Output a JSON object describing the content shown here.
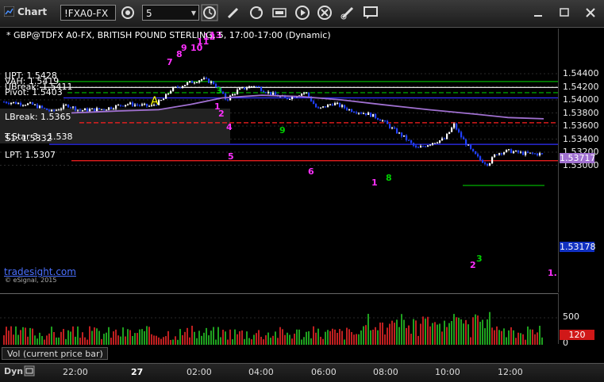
{
  "window": {
    "title": "Chart",
    "symbol": "!FXA0-FX",
    "interval": "5"
  },
  "chart_header": "* GBP@TDFX A0-FX, BRITISH POUND STERLING, 5, 17:00-17:00 (Dynamic)",
  "levels": [
    {
      "label": "UPT: 1.5428",
      "price": 1.5428,
      "color": "#00b000",
      "style": "solid"
    },
    {
      "label": "VAH: 1.5419",
      "price": 1.5419,
      "color": "#ffffff",
      "style": "solid"
    },
    {
      "label": "UBreak: 1.5411",
      "price": 1.5411,
      "color": "#00c000",
      "style": "dashed"
    },
    {
      "label": "Pivot: 1.5403",
      "price": 1.5403,
      "color": "#3030ff",
      "style": "solid"
    },
    {
      "label": "LBreak: 1.5365",
      "price": 1.5365,
      "color": "#ff2020",
      "style": "dashed"
    },
    {
      "label": "S1: 1.5332",
      "price": 1.5332,
      "color": "#3030ff",
      "style": "solid"
    },
    {
      "label": "LPT: 1.5307",
      "price": 1.5307,
      "color": "#ff2020",
      "style": "solid"
    }
  ],
  "tstar_label": "T.Star 3:",
  "tstar_value": "1.538",
  "marker_a": "A",
  "watermark": {
    "brand": "tradesight.com",
    "copyright": "© eSignal, 2015"
  },
  "price_axis": {
    "ticks": [
      "1.54400",
      "1.54200",
      "1.54000",
      "1.53800",
      "1.53600",
      "1.53400",
      "1.53200",
      "1.53000"
    ],
    "last_price": "1.53178",
    "ma_value": "1.53717"
  },
  "volume": {
    "label": "Vol (current price bar)",
    "ticks": [
      "500",
      "0"
    ],
    "last": "120"
  },
  "time_axis": [
    "22:00",
    "27",
    "02:00",
    "04:00",
    "06:00",
    "08:00",
    "10:00",
    "12:00"
  ],
  "bottom": {
    "mode": "Dyn"
  },
  "counts": [
    {
      "t": "7",
      "c": "#ff30ff"
    },
    {
      "t": "8",
      "c": "#ff30ff"
    },
    {
      "t": "9",
      "c": "#ff30ff"
    },
    {
      "t": "10",
      "c": "#ff30ff"
    },
    {
      "t": "11",
      "c": "#ff30ff"
    },
    {
      "t": "12",
      "c": "#ff30ff"
    },
    {
      "t": "13",
      "c": "#ff30ff"
    },
    {
      "t": "1",
      "c": "#ff30ff"
    },
    {
      "t": "2",
      "c": "#ff30ff"
    },
    {
      "t": "3",
      "c": "#00d000"
    },
    {
      "t": "4",
      "c": "#ff30ff"
    },
    {
      "t": "5",
      "c": "#ff30ff"
    },
    {
      "t": "6",
      "c": "#ff30ff"
    },
    {
      "t": "9",
      "c": "#00d000"
    },
    {
      "t": "1",
      "c": "#ff30ff"
    },
    {
      "t": "2",
      "c": "#ff30ff"
    },
    {
      "t": "3",
      "c": "#00d000"
    },
    {
      "t": "8",
      "c": "#00d000"
    },
    {
      "t": "1.",
      "c": "#ff30ff"
    }
  ],
  "colors": {
    "up": "#ffffff",
    "down": "#2040ff",
    "ma": "#a070d0",
    "last_box": "#1030c0",
    "ma_box": "#a070d0"
  }
}
